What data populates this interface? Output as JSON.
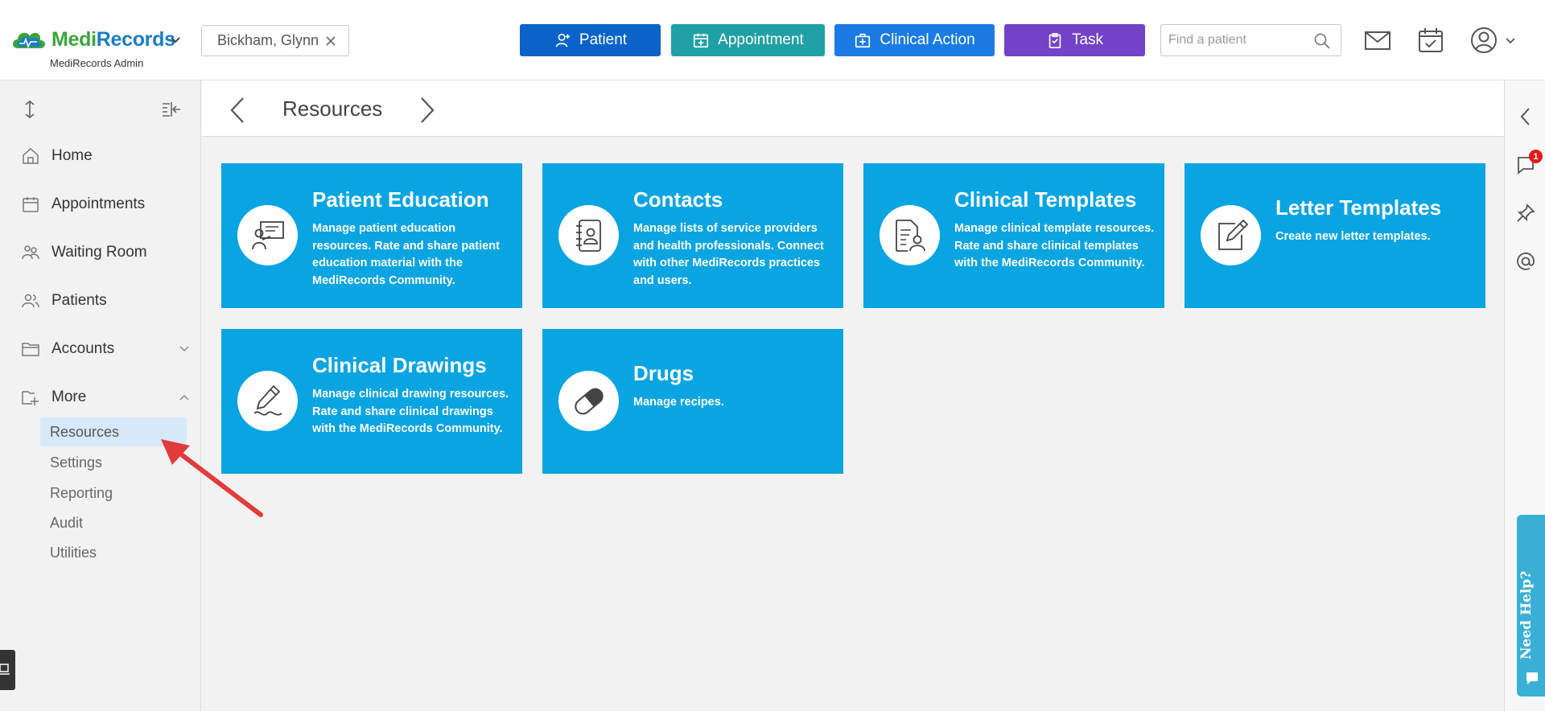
{
  "header": {
    "logo_part1": "Medi",
    "logo_part2": "Records",
    "logo_sub": "MediRecords Admin",
    "patient_chip": "Bickham, Glynn",
    "buttons": {
      "patient": "Patient",
      "appointment": "Appointment",
      "clinical_action": "Clinical Action",
      "task": "Task"
    },
    "search_placeholder": "Find a patient",
    "colors": {
      "patient": "#0a63c9",
      "appointment": "#1fa0a4",
      "clinical_action": "#1c7be3",
      "task": "#7342c6"
    }
  },
  "sidebar": {
    "items": [
      {
        "label": "Home",
        "icon": "home-icon"
      },
      {
        "label": "Appointments",
        "icon": "calendar-icon"
      },
      {
        "label": "Waiting Room",
        "icon": "waiting-room-icon"
      },
      {
        "label": "Patients",
        "icon": "patients-icon"
      },
      {
        "label": "Accounts",
        "icon": "folder-icon",
        "expandable": true,
        "expanded": false
      },
      {
        "label": "More",
        "icon": "folder-plus-icon",
        "expandable": true,
        "expanded": true
      }
    ],
    "sub_items": [
      "Resources",
      "Settings",
      "Reporting",
      "Audit",
      "Utilities"
    ],
    "active_sub_item": "Resources"
  },
  "main": {
    "title": "Resources",
    "tiles": [
      {
        "title": "Patient Education",
        "desc": "Manage patient education resources. Rate and share patient education material with the MediRecords Community.",
        "icon": "presentation-icon"
      },
      {
        "title": "Contacts",
        "desc": "Manage lists of service providers and health professionals. Connect with other MediRecords practices and users.",
        "icon": "address-book-icon"
      },
      {
        "title": "Clinical Templates",
        "desc": "Manage clinical template resources. Rate and share clinical templates with the MediRecords Community.",
        "icon": "template-user-icon"
      },
      {
        "title": "Letter Templates",
        "desc": "Create new letter templates.",
        "icon": "edit-document-icon"
      },
      {
        "title": "Clinical Drawings",
        "desc": "Manage clinical drawing resources. Rate and share clinical drawings with the MediRecords Community.",
        "icon": "pencil-drawing-icon"
      },
      {
        "title": "Drugs",
        "desc": "Manage recipes.",
        "icon": "pill-icon"
      }
    ],
    "tile_color": "#09a4e2"
  },
  "right_rail": {
    "notification_count": "1",
    "help_label": "Need Help?"
  }
}
